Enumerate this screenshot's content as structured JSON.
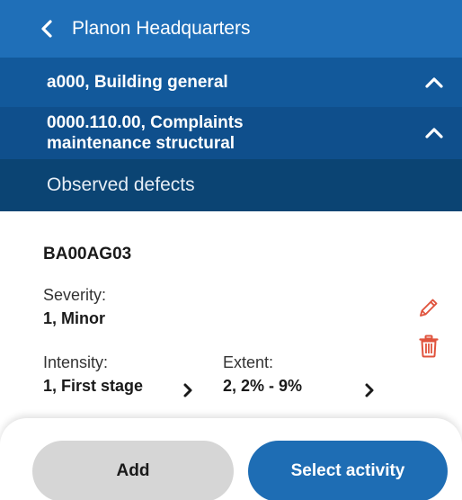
{
  "header": {
    "title": "Planon Headquarters"
  },
  "breadcrumb": {
    "level1": "a000, Building general",
    "level2": "0000.110.00, Complaints maintenance structural",
    "level3": "Observed defects"
  },
  "defect": {
    "code": "BA00AG03",
    "severity_label": "Severity:",
    "severity_value": "1, Minor",
    "intensity_label": "Intensity:",
    "intensity_value": "1, First stage",
    "extent_label": "Extent:",
    "extent_value": "2, 2% - 9%"
  },
  "footer": {
    "add_label": "Add",
    "select_label": "Select activity"
  },
  "colors": {
    "header": "#1f6fb8",
    "level1": "#12599b",
    "level2": "#0f4f8c",
    "level3": "#0b4473",
    "accent_red": "#e0533d",
    "primary_button": "#1e6db4"
  }
}
